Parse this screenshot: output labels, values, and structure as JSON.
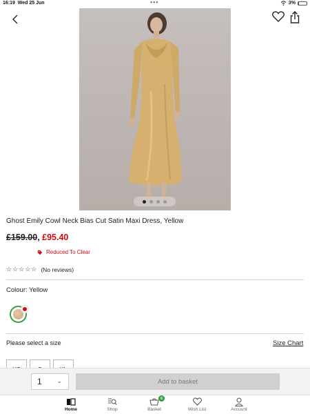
{
  "status_bar": {
    "time": "16:19",
    "date": "Wed 25 Jun",
    "battery": "3%"
  },
  "product": {
    "title": "Ghost Emily Cowl Neck Bias Cut Satin Maxi Dress, Yellow",
    "old_price": "£159.00",
    "separator": ",",
    "new_price": "£95.40",
    "reduced_label": "Reduced To Clear",
    "stars": "☆☆☆☆☆",
    "reviews": "(No reviews)",
    "image_count": 4,
    "active_image": 1
  },
  "colour": {
    "label": "Colour: Yellow"
  },
  "size": {
    "prompt": "Please select a size",
    "chart_link": "Size Chart",
    "options": [
      "XS",
      "S",
      "XL"
    ]
  },
  "purchase": {
    "quantity": "1",
    "add_label": "Add to basket"
  },
  "tabbar": {
    "home": "Home",
    "shop": "Shop",
    "basket": "Basket",
    "basket_count": "6",
    "wishlist": "Wish List",
    "account": "Account"
  },
  "colors": {
    "sale_red": "#d10a11",
    "accent_green": "#2f9e44",
    "disabled_button": "#d0d0d0"
  }
}
